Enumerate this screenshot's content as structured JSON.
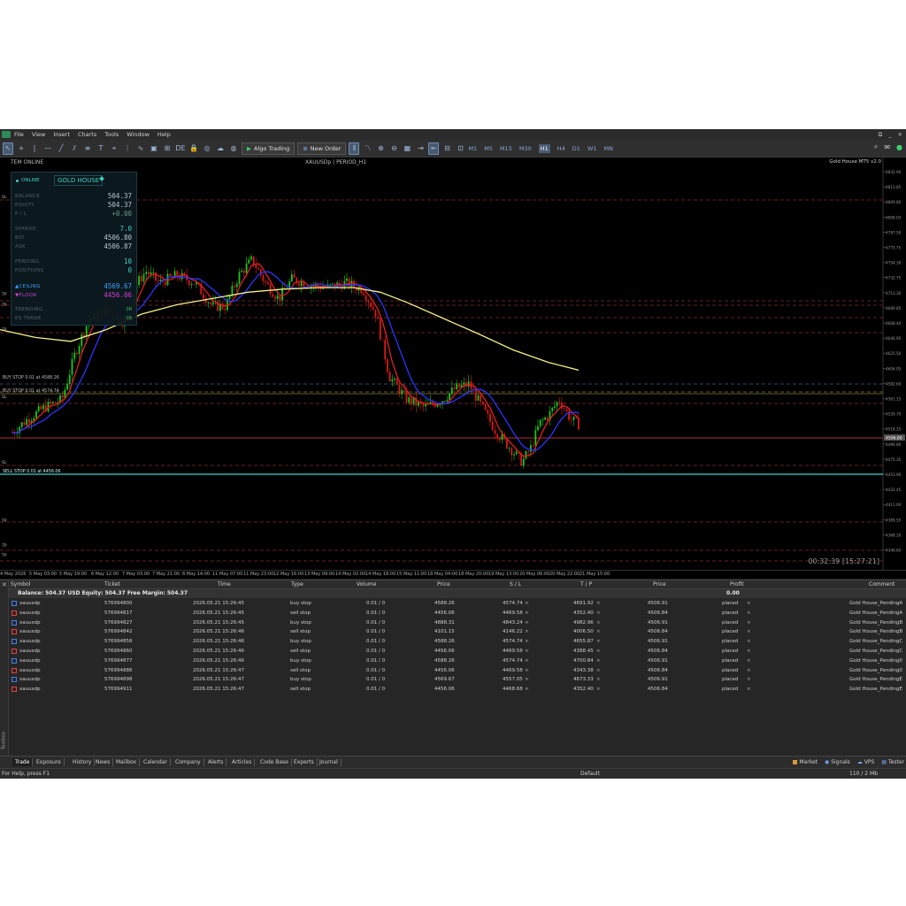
{
  "menu": [
    "File",
    "View",
    "Insert",
    "Charts",
    "Tools",
    "Window",
    "Help"
  ],
  "toolbar": {
    "algo_trading": "Algo Trading",
    "new_order": "New Order",
    "timeframes": [
      "M1",
      "M5",
      "M15",
      "M30",
      "H1",
      "H4",
      "D1",
      "W1",
      "MN"
    ],
    "active_timeframe": "H1"
  },
  "chart": {
    "symbol_header": "XAUUSDp",
    "period_header": "PERIOD_H1",
    "status_left": "TEM ONLINE",
    "ea_label": "Gold House MT5 v2.0",
    "clock": "00:32:39 [15:27:21]",
    "colors": {
      "bull": "#19c919",
      "bear": "#d91a1a",
      "ma_red": "#e02020",
      "ma_blue": "#2a35ff",
      "ma_yellow": "#f3f08a",
      "cyan": "#3ad6c8",
      "red_line": "#b03030"
    },
    "price_axis": [
      "4832.90",
      "4813.85",
      "4809.80",
      "4808.03",
      "4787.50",
      "4775.75",
      "4754.30",
      "4732.75",
      "4713.30",
      "4689.85",
      "4668.40",
      "4646.95",
      "4625.50",
      "4604.05",
      "4582.60",
      "4561.15",
      "4539.70",
      "4518.25",
      "4496.80",
      "4475.35",
      "4453.90",
      "4432.45",
      "4411.00",
      "4389.55",
      "4368.10",
      "4346.65"
    ],
    "current_price": "4506.80",
    "date_axis": [
      "4 May 2026",
      "5 May 03:00",
      "5 May 19:00",
      "6 May 12:00",
      "7 May 03:00",
      "7 May 21:00",
      "8 May 14:00",
      "11 May 07:00",
      "11 May 23:00",
      "12 May 16:00",
      "13 May 09:00",
      "14 May 02:00",
      "14 May 18:00",
      "15 May 11:00",
      "18 May 04:00",
      "18 May 20:00",
      "19 May 13:00",
      "20 May 06:00",
      "20 May 22:00",
      "21 May 15:00"
    ],
    "line_labels": {
      "buy_stop": "BUY STOP 0.01 at 4588.26",
      "buy_stop2": "BUY STOP 0.01 at 4574.74",
      "sell_stop": "SELL STOP 0.01 at 4456.06"
    },
    "left_tags": [
      "SL",
      "TP",
      "TP",
      "TP",
      "SL",
      "SL",
      "TP",
      "TP",
      "TP"
    ]
  },
  "panel": {
    "status": "ONLINE",
    "brand": "GOLD HOUSE",
    "balance_label": "BALANCE",
    "balance": "504.37",
    "equity_label": "EQUITY",
    "equity": "504.37",
    "pl_label": "P / L",
    "pl": "+0.00",
    "spread_label": "SPREAD",
    "spread": "7.0",
    "bid_label": "BID",
    "bid": "4506.80",
    "ask_label": "ASK",
    "ask": "4506.87",
    "pending_label": "PENDING",
    "pending": "10",
    "positions_label": "POSITIONS",
    "positions": "0",
    "ceiling_label": "▲CEILING",
    "ceiling": "4569.67",
    "floor_label": "▼FLOOR",
    "floor": "4456.06",
    "trending_label": "TRENDING",
    "trending": "ON",
    "es_label": "ES TRADE",
    "es": "ON"
  },
  "trade": {
    "headers": {
      "symbol": "Symbol",
      "ticket": "Ticket",
      "time": "Time",
      "type": "Type",
      "volume": "Volume",
      "price": "Price",
      "sl": "S / L",
      "tp": "T / P",
      "cur_price": "Price",
      "profit": "Profit",
      "comment": "Comment"
    },
    "balance_line": "Balance: 504.37 USD  Equity: 504.37  Free Margin: 504.37",
    "balance_profit": "0.00",
    "rows": [
      {
        "symbol": "xauusdp",
        "ticket": "576994800",
        "time": "2026.05.21 15:26:45",
        "type": "buy stop",
        "volume": "0.01 / 0",
        "price": "4588.26",
        "sl": "4574.74",
        "tp": "4691.92",
        "cur": "4506.91",
        "profit": "placed",
        "comment": "Gold House_PendingA"
      },
      {
        "symbol": "xauusdp",
        "ticket": "576994817",
        "time": "2026.05.21 15:26:45",
        "type": "sell stop",
        "volume": "0.01 / 0",
        "price": "4456.06",
        "sl": "4469.58",
        "tp": "4352.40",
        "cur": "4506.84",
        "profit": "placed",
        "comment": "Gold House_PendingA"
      },
      {
        "symbol": "xauusdp",
        "ticket": "576994827",
        "time": "2026.05.21 15:26:45",
        "type": "buy stop",
        "volume": "0.01 / 0",
        "price": "4888.31",
        "sl": "4843.24",
        "tp": "4982.96",
        "cur": "4506.91",
        "profit": "placed",
        "comment": "Gold House_PendingB"
      },
      {
        "symbol": "xauusdp",
        "ticket": "576994842",
        "time": "2026.05.21 15:26:46",
        "type": "sell stop",
        "volume": "0.01 / 0",
        "price": "4101.15",
        "sl": "4146.22",
        "tp": "4006.50",
        "cur": "4506.84",
        "profit": "placed",
        "comment": "Gold House_PendingB"
      },
      {
        "symbol": "xauusdp",
        "ticket": "576994858",
        "time": "2026.05.21 15:26:46",
        "type": "buy stop",
        "volume": "0.01 / 0",
        "price": "4588.26",
        "sl": "4574.74",
        "tp": "4655.87",
        "cur": "4506.91",
        "profit": "placed",
        "comment": "Gold House_PendingC"
      },
      {
        "symbol": "xauusdp",
        "ticket": "576994860",
        "time": "2026.05.21 15:26:46",
        "type": "sell stop",
        "volume": "0.01 / 0",
        "price": "4456.06",
        "sl": "4469.58",
        "tp": "4388.45",
        "cur": "4506.84",
        "profit": "placed",
        "comment": "Gold House_PendingC"
      },
      {
        "symbol": "xauusdp",
        "ticket": "576994877",
        "time": "2026.05.21 15:26:46",
        "type": "buy stop",
        "volume": "0.01 / 0",
        "price": "4588.26",
        "sl": "4574.74",
        "tp": "4700.84",
        "cur": "4506.91",
        "profit": "placed",
        "comment": "Gold House_Pending0"
      },
      {
        "symbol": "xauusdp",
        "ticket": "576994886",
        "time": "2026.05.21 15:26:47",
        "type": "sell stop",
        "volume": "0.01 / 0",
        "price": "4456.06",
        "sl": "4469.58",
        "tp": "4343.38",
        "cur": "4506.84",
        "profit": "placed",
        "comment": "Gold House_Pending0"
      },
      {
        "symbol": "xauusdp",
        "ticket": "576994898",
        "time": "2026.05.21 15:26:47",
        "type": "buy stop",
        "volume": "0.01 / 0",
        "price": "4569.67",
        "sl": "4557.05",
        "tp": "4673.33",
        "cur": "4506.91",
        "profit": "placed",
        "comment": "Gold House_PendingE"
      },
      {
        "symbol": "xauusdp",
        "ticket": "576994911",
        "time": "2026.05.21 15:26:47",
        "type": "sell stop",
        "volume": "0.01 / 0",
        "price": "4456.06",
        "sl": "4468.68",
        "tp": "4352.40",
        "cur": "4506.84",
        "profit": "placed",
        "comment": "Gold House_PendingE"
      }
    ]
  },
  "bottom_tabs": [
    "Trade",
    "Exposure",
    "History",
    "News",
    "Mailbox",
    "Calendar",
    "Company",
    "Alerts",
    "Articles",
    "Code Base",
    "Experts",
    "Journal"
  ],
  "bottom_right": [
    "Market",
    "Signals",
    "VPS",
    "Tester"
  ],
  "toolbox_label": "Toolbox",
  "status": {
    "help": "For Help, press F1",
    "profile": "Default",
    "traffic": "110 / 2 Mb"
  }
}
